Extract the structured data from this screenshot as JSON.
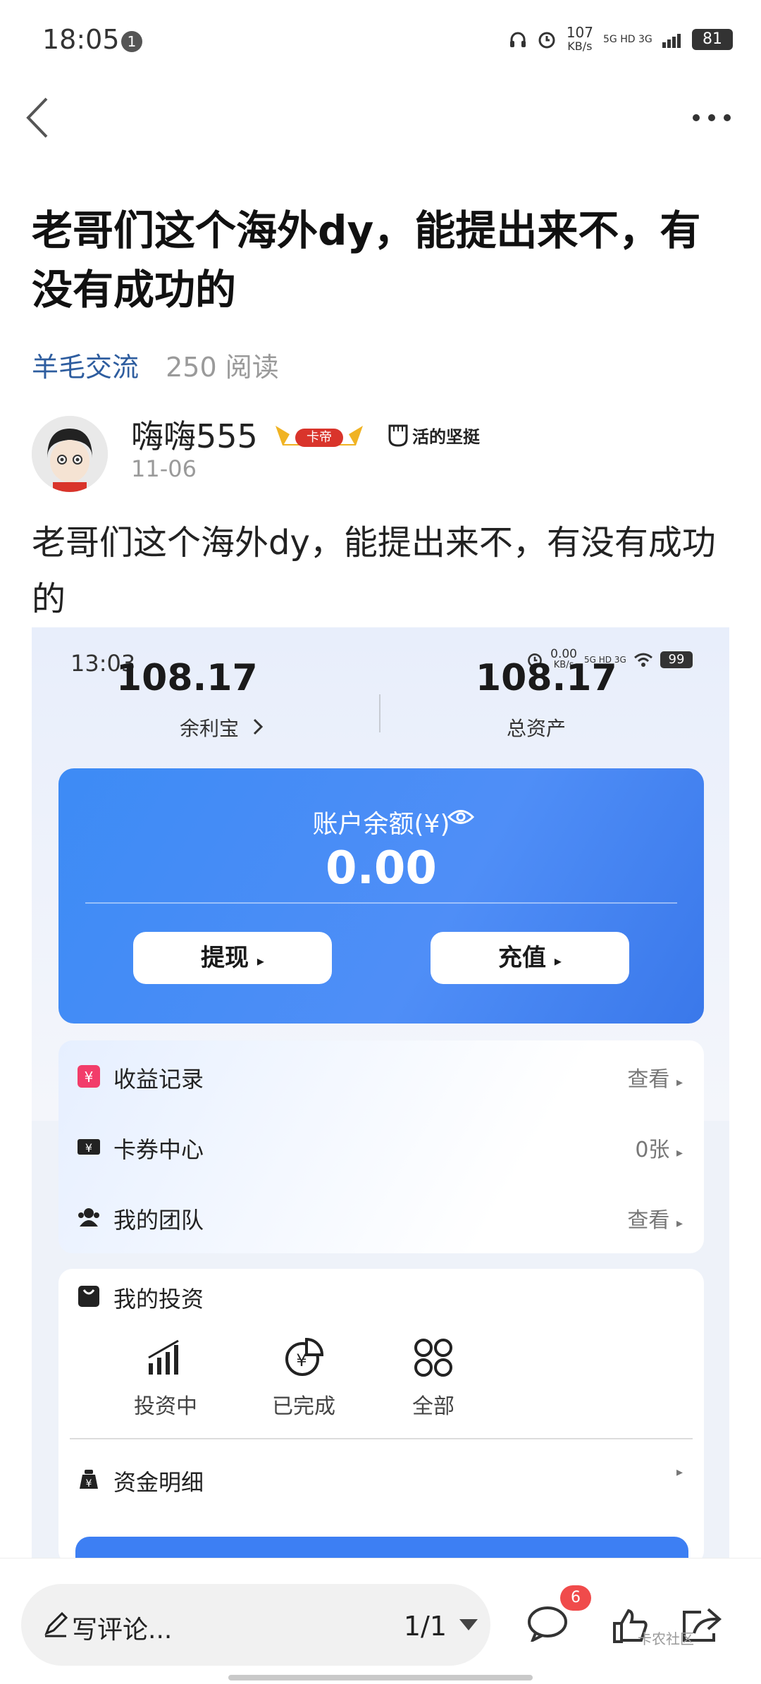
{
  "status_bar": {
    "time": "18:05",
    "notif_count": "1",
    "net_speed_value": "107",
    "net_speed_unit": "KB/s",
    "signal_labels": "5G HD 3G",
    "battery": "81"
  },
  "post": {
    "title": "老哥们这个海外dy，能提出来不，有没有成功的",
    "category": "羊毛交流",
    "reads": "250 阅读",
    "author": "嗨嗨555",
    "badge_text": "卡帝",
    "badge2_text": "活的坚挺",
    "date": "11-06",
    "body": "老哥们这个海外dy，能提出来不，有没有成功的"
  },
  "embedded_app": {
    "status": {
      "time": "13:03",
      "speed": "0.00",
      "speed_unit": "KB/s",
      "signal_labels": "5G HD 3G",
      "battery": "99"
    },
    "left_value": "108.17",
    "left_label": "余利宝",
    "right_value": "108.17",
    "right_label": "总资产",
    "card_title": "账户余额(¥)",
    "card_value": "0.00",
    "withdraw_label": "提现",
    "recharge_label": "充值",
    "menu": [
      {
        "label": "收益记录",
        "value": "查看"
      },
      {
        "label": "卡券中心",
        "value": "0张"
      },
      {
        "label": "我的团队",
        "value": "查看"
      }
    ],
    "invest_title": "我的投资",
    "invest_items": [
      "投资中",
      "已完成",
      "全部"
    ],
    "funds_label": "资金明细"
  },
  "bottom_bar": {
    "comment_placeholder": "写评论...",
    "pager": "1/1",
    "comment_count": "6",
    "watermark": "卡农社区"
  },
  "colors": {
    "category": "#2e5d9f",
    "card_blue": "#4f8ef7",
    "badge_red": "#f04b4b"
  }
}
